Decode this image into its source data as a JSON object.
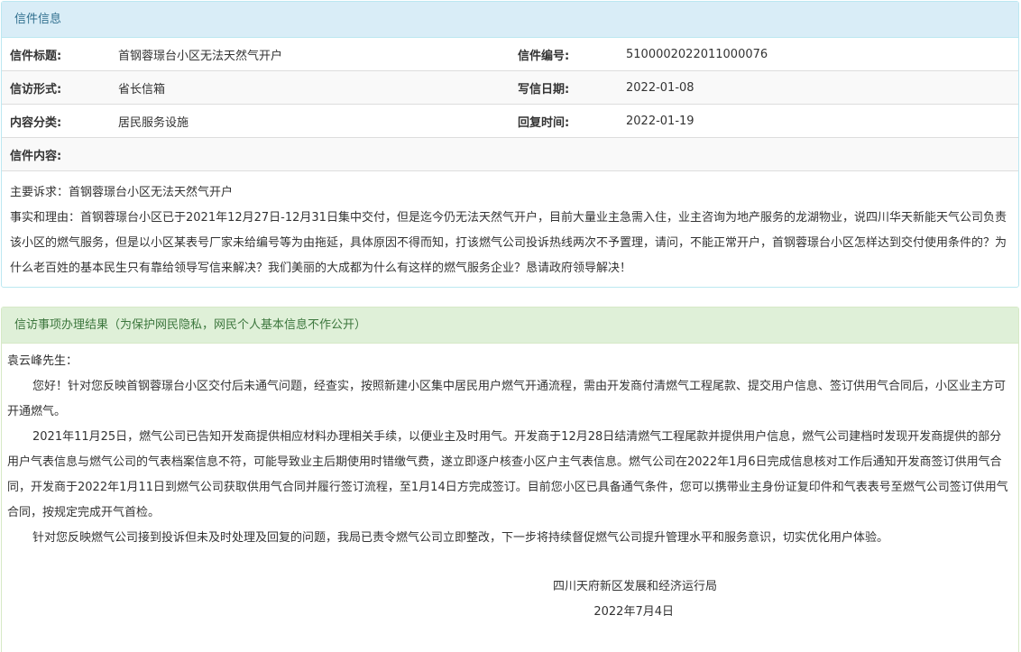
{
  "letter": {
    "heading": "信件信息",
    "rows": [
      {
        "label1": "信件标题:",
        "value1": "首钢蓉璟台小区无法天然气开户",
        "label2": "信件编号:",
        "value2": "5100002022011000076"
      },
      {
        "label1": "信访形式:",
        "value1": "省长信箱",
        "label2": "写信日期:",
        "value2": "2022-01-08"
      },
      {
        "label1": "内容分类:",
        "value1": "居民服务设施",
        "label2": "回复时间:",
        "value2": "2022-01-19"
      }
    ],
    "content_label": "信件内容:",
    "content_lines": [
      "主要诉求：首钢蓉璟台小区无法天然气开户",
      "事实和理由：首钢蓉璟台小区已于2021年12月27日-12月31日集中交付，但是迄今仍无法天然气开户，目前大量业主急需入住，业主咨询为地产服务的龙湖物业，说四川华天新能天气公司负责该小区的燃气服务，但是以小区某表号厂家未给编号等为由拖延，具体原因不得而知，打该燃气公司投诉热线两次不予置理，请问，不能正常开户，首钢蓉璟台小区怎样达到交付使用条件的？为什么老百姓的基本民生只有靠给领导写信来解决？我们美丽的大成都为什么有这样的燃气服务企业？恳请政府领导解决！"
    ]
  },
  "result": {
    "heading": "信访事项办理结果（为保护网民隐私，网民个人基本信息不作公开）",
    "salutation": "袁云峰先生：",
    "paragraphs": [
      "您好！针对您反映首钢蓉璟台小区交付后未通气问题，经查实，按照新建小区集中居民用户燃气开通流程，需由开发商付清燃气工程尾款、提交用户信息、签订供用气合同后，小区业主方可开通燃气。",
      "2021年11月25日，燃气公司已告知开发商提供相应材料办理相关手续，以便业主及时用气。开发商于12月28日结清燃气工程尾款并提供用户信息，燃气公司建档时发现开发商提供的部分用户气表信息与燃气公司的气表档案信息不符，可能导致业主后期使用时错缴气费，遂立即逐户核查小区户主气表信息。燃气公司在2022年1月6日完成信息核对工作后通知开发商签订供用气合同，开发商于2022年1月11日到燃气公司获取供用气合同并履行签订流程，至1月14日方完成签订。目前您小区已具备通气条件，您可以携带业主身份证复印件和气表表号至燃气公司签订供用气合同，按规定完成开气首检。",
      "针对您反映燃气公司接到投诉但未及时处理及回复的问题，我局已责令燃气公司立即整改，下一步将持续督促燃气公司提升管理水平和服务意识，切实优化用户体验。"
    ],
    "signature": "四川天府新区发展和经济运行局",
    "date": "2022年7月4日"
  }
}
